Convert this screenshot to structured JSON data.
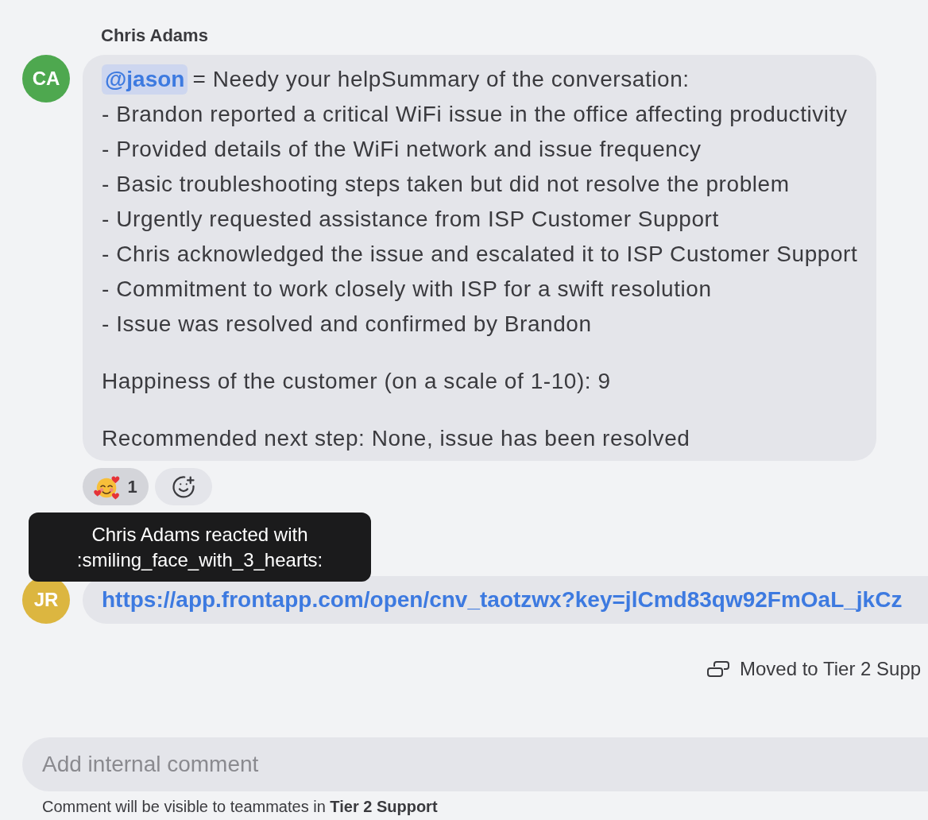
{
  "messages": [
    {
      "kind": "note",
      "author": "Chris Adams",
      "avatar": {
        "initials": "CA",
        "color": "#4ea84f"
      },
      "mention": "@jason",
      "intro": "= Needy your helpSummary of the conversation:",
      "lines": [
        "- Brandon reported a critical WiFi issue in the office affecting productivity",
        "- Provided details of the WiFi network and issue frequency",
        "- Basic troubleshooting steps taken but did not resolve the problem",
        "- Urgently requested assistance from ISP Customer Support",
        "- Chris acknowledged the issue and escalated it to ISP Customer Support",
        "- Commitment to work closely with ISP for a swift resolution",
        "- Issue was resolved and confirmed by Brandon"
      ],
      "paragraphs": [
        "Happiness of the customer (on a scale of 1-10): 9",
        "Recommended next step: None, issue has been resolved"
      ],
      "reactions": [
        {
          "count": "1",
          "selected": true,
          "tooltip": "Chris Adams reacted with :smiling_face_with_3_hearts:"
        }
      ]
    },
    {
      "kind": "link",
      "avatar": {
        "initials": "JR",
        "color": "#dcb640"
      },
      "link": "https://app.frontapp.com/open/cnv_taotzwx?key=jlCmd83qw92FmOaL_jkCz"
    }
  ],
  "event": {
    "text": "Moved to Tier 2 Supp"
  },
  "composer": {
    "placeholder": "Add internal comment",
    "note": "Comment will be visible to teammates in **Tier 2 Support**"
  }
}
